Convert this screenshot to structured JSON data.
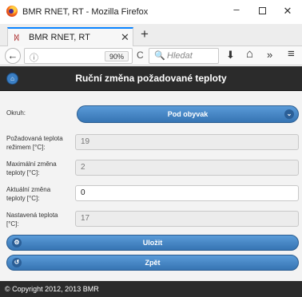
{
  "window": {
    "title": "BMR RNET, RT - Mozilla Firefox",
    "minimize_glyph": "–",
    "close_glyph": "✕"
  },
  "tabs": [
    {
      "label": "BMR RNET, RT",
      "close_glyph": "✕"
    }
  ],
  "tabbar": {
    "new_tab_glyph": "+"
  },
  "navbar": {
    "back_glyph": "←",
    "info_glyph": "ⓘ",
    "zoom": "90%",
    "reload_glyph": "C",
    "search_glyph": "🔍",
    "search_placeholder": "Hledat",
    "download_glyph": "⬇",
    "home_glyph": "⌂",
    "overflow_glyph": "»",
    "menu_glyph": "≡"
  },
  "page": {
    "title": "Ruční změna požadované teploty",
    "home_glyph": "⌂",
    "okruh": {
      "label": "Okruh:",
      "selected": "Pod obyvak",
      "chevron_glyph": "⌄"
    },
    "fields": [
      {
        "label": "Požadovaná teplota režimem [°C]:",
        "value": "19",
        "editable": false
      },
      {
        "label": "Maximální změna teploty [°C]:",
        "value": "2",
        "editable": false
      },
      {
        "label": "Aktuální změna teploty [°C]:",
        "value": "0",
        "editable": true
      },
      {
        "label": "Nastavená teplota [°C]:",
        "value": "17",
        "editable": false
      }
    ],
    "buttons": {
      "save": {
        "label": "Uložit",
        "glyph": "⚙"
      },
      "back": {
        "label": "Zpět",
        "glyph": "↺"
      }
    },
    "footer": "© Copyright 2012, 2013 BMR"
  },
  "colors": {
    "accent": "#3a7cc0",
    "header_bg": "#2b2b2b",
    "tab_highlight": "#0a84ff"
  }
}
